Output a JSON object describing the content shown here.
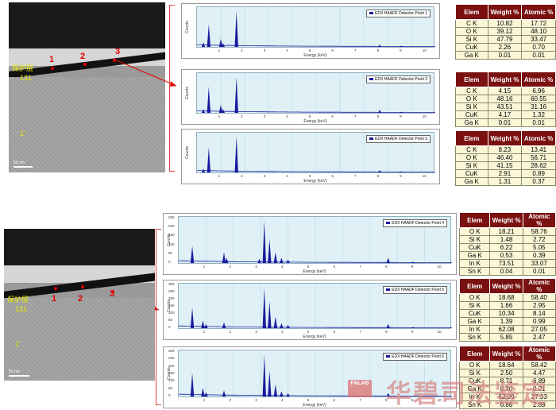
{
  "groups": [
    {
      "image": {
        "label_cn": "保护层",
        "label_131": "131",
        "label_1p": "1'",
        "scale": "50 nm",
        "points": [
          "1",
          "2",
          "3"
        ]
      },
      "spectra": [
        {
          "legend": "EDX HAADF Detector Point 1",
          "ylabel": "Counts",
          "xlabel": "Energy (keV)",
          "peaks": [
            {
              "label": "C",
              "energy": 0.28,
              "height": 0.12
            },
            {
              "label": "O",
              "energy": 0.52,
              "height": 0.62
            },
            {
              "label": "Ga Ga",
              "energy": 1.05,
              "height": 0.22
            },
            {
              "label": "Ga",
              "energy": 1.15,
              "height": 0.1
            },
            {
              "label": "Si",
              "energy": 1.74,
              "height": 0.98
            },
            {
              "label": "Cu",
              "energy": 8.05,
              "height": 0.06
            },
            {
              "label": "Cu Ga",
              "energy": 9.0,
              "height": 0.03
            }
          ]
        },
        {
          "legend": "EDX HAADF Detector Point 2",
          "ylabel": "Counts",
          "xlabel": "Energy (keV)",
          "peaks": [
            {
              "label": "C",
              "energy": 0.28,
              "height": 0.1
            },
            {
              "label": "O",
              "energy": 0.52,
              "height": 0.72
            },
            {
              "label": "Ga Ga",
              "energy": 1.05,
              "height": 0.22
            },
            {
              "label": "Cu",
              "energy": 1.15,
              "height": 0.1
            },
            {
              "label": "Si",
              "energy": 1.74,
              "height": 0.98
            },
            {
              "label": "Cu",
              "energy": 8.05,
              "height": 0.08
            },
            {
              "label": "Cu Ga",
              "energy": 9.0,
              "height": 0.03
            }
          ]
        },
        {
          "legend": "EDX HAADF Detector Point 3",
          "ylabel": "Counts",
          "xlabel": "Energy (keV)",
          "peaks": [
            {
              "label": "C",
              "energy": 0.28,
              "height": 0.1
            },
            {
              "label": "O",
              "energy": 0.52,
              "height": 0.68
            },
            {
              "label": "Si",
              "energy": 1.74,
              "height": 0.98
            },
            {
              "label": "Cu",
              "energy": 8.05,
              "height": 0.06
            },
            {
              "label": "Cu",
              "energy": 9.0,
              "height": 0.03
            }
          ]
        }
      ],
      "tables": [
        {
          "rows": [
            [
              "C K",
              "10.82",
              "17.72"
            ],
            [
              "O K",
              "39.12",
              "48.10"
            ],
            [
              "Si K",
              "47.79",
              "33.47"
            ],
            [
              "CuK",
              "2.26",
              "0.70"
            ],
            [
              "Ga K",
              "0.01",
              "0.01"
            ]
          ]
        },
        {
          "rows": [
            [
              "C K",
              "4.15",
              "6.96"
            ],
            [
              "O K",
              "48.16",
              "60.55"
            ],
            [
              "Si K",
              "43.51",
              "31.16"
            ],
            [
              "CuK",
              "4.17",
              "1.32"
            ],
            [
              "Ga K",
              "0.01",
              "0.01"
            ]
          ]
        },
        {
          "rows": [
            [
              "C K",
              "8.23",
              "13.41"
            ],
            [
              "O K",
              "46.40",
              "56.71"
            ],
            [
              "Si K",
              "41.15",
              "28.62"
            ],
            [
              "CuK",
              "2.91",
              "0.89"
            ],
            [
              "Ga K",
              "1.31",
              "0.37"
            ]
          ]
        }
      ]
    },
    {
      "image": {
        "label_cn": "保护层",
        "label_131": "131",
        "label_1p": "1'",
        "scale": "50 nm",
        "points": [
          "1",
          "2",
          "3"
        ]
      },
      "spectra": [
        {
          "legend": "EDX HAADF Detector Point 4",
          "ylabel": "Counts",
          "xlabel": "Energy (keV)",
          "yticks": [
            "250",
            "200",
            "150",
            "100",
            "50",
            "0"
          ],
          "peaks": [
            {
              "label": "O",
              "energy": 0.52,
              "height": 0.4
            },
            {
              "label": "Si",
              "energy": 1.74,
              "height": 0.25
            },
            {
              "label": "Si",
              "energy": 1.84,
              "height": 0.12
            },
            {
              "label": "In In",
              "energy": 3.1,
              "height": 0.1
            },
            {
              "label": "In",
              "energy": 3.29,
              "height": 0.98
            },
            {
              "label": "In",
              "energy": 3.49,
              "height": 0.55
            },
            {
              "label": "In",
              "energy": 3.72,
              "height": 0.25
            },
            {
              "label": "In",
              "energy": 3.95,
              "height": 0.12
            },
            {
              "label": "In",
              "energy": 4.2,
              "height": 0.08
            },
            {
              "label": "Cu",
              "energy": 8.05,
              "height": 0.12
            },
            {
              "label": "Cu Ga",
              "energy": 9.0,
              "height": 0.03
            }
          ]
        },
        {
          "legend": "EDX HAADF Detector Point 5",
          "ylabel": "Counts",
          "xlabel": "Energy (keV)",
          "yticks": [
            "300",
            "250",
            "200",
            "150",
            "100",
            "50",
            "0"
          ],
          "peaks": [
            {
              "label": "O",
              "energy": 0.52,
              "height": 0.5
            },
            {
              "label": "CuCu",
              "energy": 0.93,
              "height": 0.18
            },
            {
              "label": "Cu",
              "energy": 1.05,
              "height": 0.1
            },
            {
              "label": "Si",
              "energy": 1.74,
              "height": 0.14
            },
            {
              "label": "In",
              "energy": 3.29,
              "height": 0.98
            },
            {
              "label": "In",
              "energy": 3.49,
              "height": 0.65
            },
            {
              "label": "In",
              "energy": 3.72,
              "height": 0.28
            },
            {
              "label": "In",
              "energy": 3.95,
              "height": 0.12
            },
            {
              "label": "In",
              "energy": 4.2,
              "height": 0.08
            },
            {
              "label": "Cu",
              "energy": 8.05,
              "height": 0.1
            },
            {
              "label": "Cu Ga",
              "energy": 9.0,
              "height": 0.03
            }
          ]
        },
        {
          "legend": "EDX HAADF Detector Point 6",
          "ylabel": "Counts",
          "xlabel": "Energy (keV)",
          "yticks": [
            "300",
            "250",
            "200",
            "150",
            "100",
            "50",
            "0"
          ],
          "peaks": [
            {
              "label": "O",
              "energy": 0.52,
              "height": 0.55
            },
            {
              "label": "CuCu",
              "energy": 0.93,
              "height": 0.2
            },
            {
              "label": "Cu",
              "energy": 1.05,
              "height": 0.1
            },
            {
              "label": "Si",
              "energy": 1.74,
              "height": 0.14
            },
            {
              "label": "In",
              "energy": 3.29,
              "height": 0.98
            },
            {
              "label": "In",
              "energy": 3.49,
              "height": 0.6
            },
            {
              "label": "In",
              "energy": 3.72,
              "height": 0.28
            },
            {
              "label": "In",
              "energy": 3.95,
              "height": 0.12
            },
            {
              "label": "In",
              "energy": 4.2,
              "height": 0.08
            },
            {
              "label": "Cu",
              "energy": 8.05,
              "height": 0.08
            }
          ]
        }
      ],
      "tables": [
        {
          "rows": [
            [
              "O K",
              "18.21",
              "58.76"
            ],
            [
              "Si K",
              "1.48",
              "2.72"
            ],
            [
              "CuK",
              "6.22",
              "5.05"
            ],
            [
              "Ga K",
              "0.53",
              "0.39"
            ],
            [
              "In K",
              "73.51",
              "33.07"
            ],
            [
              "Sn K",
              "0.04",
              "0.01"
            ]
          ]
        },
        {
          "rows": [
            [
              "O K",
              "18.68",
              "58.40"
            ],
            [
              "Si K",
              "1.66",
              "2.95"
            ],
            [
              "CuK",
              "10.34",
              "8.14"
            ],
            [
              "Ga K",
              "1.39",
              "0.99"
            ],
            [
              "In K",
              "62.08",
              "27.05"
            ],
            [
              "Sn K",
              "5.85",
              "2.47"
            ]
          ]
        },
        {
          "rows": [
            [
              "O K",
              "18.64",
              "58.42"
            ],
            [
              "Si K",
              "2.50",
              "4.47"
            ],
            [
              "CuK",
              "8.71",
              "6.89"
            ],
            [
              "Ga K",
              "0.30",
              "0.21"
            ],
            [
              "In K",
              "62.99",
              "27.33"
            ],
            [
              "Sn K",
              "6.86",
              "2.89"
            ]
          ]
        }
      ]
    }
  ],
  "xticks": [
    "1",
    "2",
    "3",
    "4",
    "5",
    "6",
    "7",
    "8",
    "9",
    "10"
  ],
  "table_header": {
    "elem": "Elem",
    "weight": "Weight %",
    "atomic": "Atomic %"
  },
  "watermark": {
    "logo": "FALAB",
    "text": "华碧司法鉴定"
  },
  "colors": {
    "spectrum": "#1a1aa0",
    "plot_bg": "#dff0f6",
    "table_header": "#7a1010",
    "table_cell": "#fbf6d6",
    "marker": "#e00000"
  }
}
